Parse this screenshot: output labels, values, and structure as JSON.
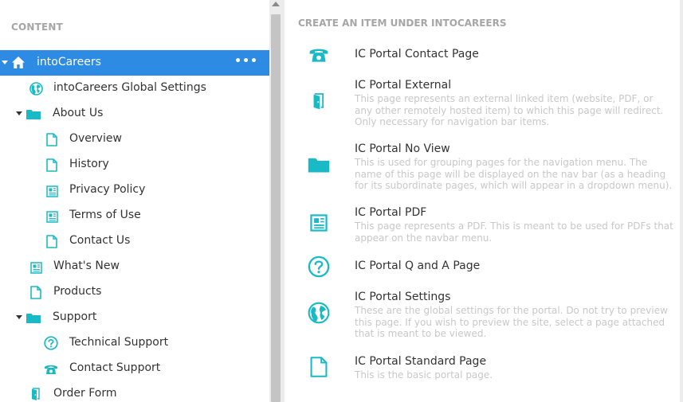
{
  "colors": {
    "accent": "#2e8be3",
    "icon": "#1ab9c6",
    "muted": "#a6a6a6"
  },
  "tree": {
    "header": "CONTENT",
    "more_label": "•••",
    "items": [
      {
        "label": "intoCareers",
        "icon": "home-icon",
        "selected": true,
        "caret": true,
        "level": 0
      },
      {
        "label": "intoCareers Global Settings",
        "icon": "globe-icon",
        "level": 1
      },
      {
        "label": "About Us",
        "icon": "folder-icon",
        "caret": true,
        "level": 1
      },
      {
        "label": "Overview",
        "icon": "document-icon",
        "level": 2
      },
      {
        "label": "History",
        "icon": "document-icon",
        "level": 2
      },
      {
        "label": "Privacy Policy",
        "icon": "newspaper-icon",
        "level": 2
      },
      {
        "label": "Terms of Use",
        "icon": "newspaper-icon",
        "level": 2
      },
      {
        "label": "Contact Us",
        "icon": "document-icon",
        "level": 2
      },
      {
        "label": "What's New",
        "icon": "newspaper-icon",
        "level": 1
      },
      {
        "label": "Products",
        "icon": "document-icon",
        "level": 1
      },
      {
        "label": "Support",
        "icon": "folder-icon",
        "caret": true,
        "level": 1
      },
      {
        "label": "Technical Support",
        "icon": "question-icon",
        "level": 2
      },
      {
        "label": "Contact Support",
        "icon": "phone-icon",
        "level": 2
      },
      {
        "label": "Order Form",
        "icon": "door-icon",
        "level": 1
      }
    ]
  },
  "create": {
    "header": "CREATE AN ITEM UNDER INTOCAREERS",
    "items": [
      {
        "name": "IC Portal Contact Page",
        "description": "",
        "icon": "phone-icon"
      },
      {
        "name": "IC Portal External",
        "description": "This page represents an external linked item (website, PDF, or any other remotely hosted item) to which this page will redirect. Only necessary for navigation bar items.",
        "icon": "door-icon"
      },
      {
        "name": "IC Portal No View",
        "description": "This is used for grouping pages for the navigation menu. The name of this page will be displayed on the nav bar (as a heading for its subordinate pages, which will appear in a dropdown menu).",
        "icon": "folder-icon"
      },
      {
        "name": "IC Portal PDF",
        "description": "This page represents a PDF. This is meant to be used for PDFs that appear on the navbar menu.",
        "icon": "newspaper-icon"
      },
      {
        "name": "IC Portal Q and A Page",
        "description": "",
        "icon": "question-icon"
      },
      {
        "name": "IC Portal Settings",
        "description": "These are the global settings for the portal. Do not try to preview this page. If you wish to preview the site, select a page attached that is meant to be viewed.",
        "icon": "globe-icon"
      },
      {
        "name": "IC Portal Standard Page",
        "description": "This is the basic portal page.",
        "icon": "document-icon"
      }
    ]
  }
}
